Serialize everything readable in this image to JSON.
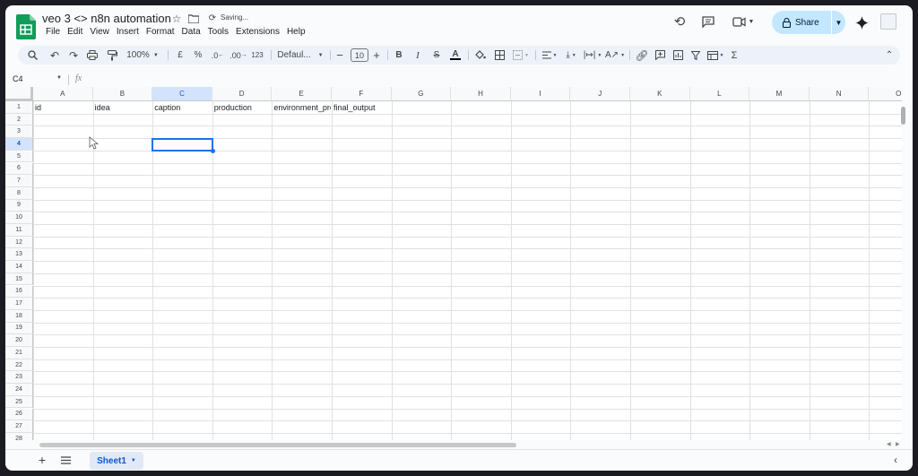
{
  "doc": {
    "title": "veo 3 <> n8n automation",
    "saving": "Saving..."
  },
  "menu": [
    "File",
    "Edit",
    "View",
    "Insert",
    "Format",
    "Data",
    "Tools",
    "Extensions",
    "Help"
  ],
  "share": {
    "label": "Share"
  },
  "toolbar": {
    "zoom": "100%",
    "currency": "£",
    "percent": "%",
    "dec_decrease": ".0",
    "dec_increase": ".00",
    "number_format": "123",
    "font": "Defaul...",
    "font_size": "10",
    "bold": "B",
    "italic": "I",
    "strike": "S",
    "text_color": "A",
    "function": "Σ"
  },
  "formula_bar": {
    "cell_ref": "C4",
    "fx": "fx"
  },
  "columns": [
    "A",
    "B",
    "C",
    "D",
    "E",
    "F",
    "G",
    "H",
    "I",
    "J",
    "K",
    "L",
    "M",
    "N",
    "O"
  ],
  "rows": [
    "1",
    "2",
    "3",
    "4",
    "5",
    "6",
    "7",
    "8",
    "9",
    "10",
    "11",
    "12",
    "13",
    "14",
    "15",
    "16",
    "17",
    "18",
    "19",
    "20",
    "21",
    "22",
    "23",
    "24",
    "25",
    "26",
    "27",
    "28"
  ],
  "header_row": [
    "id",
    "idea",
    "caption",
    "production",
    "environment_prompt",
    "final_output"
  ],
  "selected_cell": "C4",
  "sheets": [
    {
      "name": "Sheet1"
    }
  ]
}
